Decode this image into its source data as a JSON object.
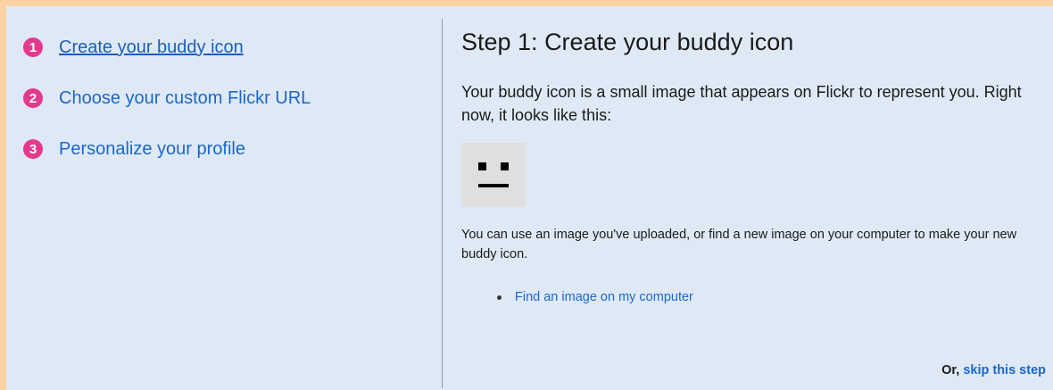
{
  "steps": [
    {
      "number": "1",
      "label": "Create your buddy icon"
    },
    {
      "number": "2",
      "label": "Choose your custom Flickr URL"
    },
    {
      "number": "3",
      "label": "Personalize your profile"
    }
  ],
  "main": {
    "title": "Step 1: Create your buddy icon",
    "description": "Your buddy icon is a small image that appears on Flickr to represent you. Right now, it looks like this:",
    "instructions": "You can use an image you've uploaded, or find a new image on your computer to make your new buddy icon.",
    "find_link": "Find an image on my computer",
    "skip_prefix": "Or,",
    "skip_link": "skip this step"
  },
  "colors": {
    "accent": "#e23a8d",
    "link": "#1c67c9",
    "background": "#dfe9f6",
    "border": "#fbd3a3"
  }
}
